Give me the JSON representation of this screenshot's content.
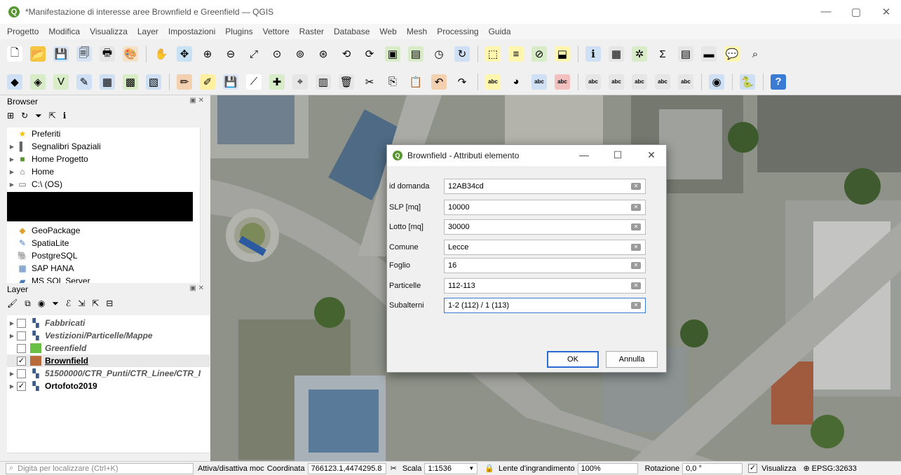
{
  "window": {
    "title": "*Manifestazione di interesse aree Brownfield e Greenfield — QGIS",
    "logo_letter": "Q",
    "minimize": "—",
    "maximize": "▢",
    "close": "✕"
  },
  "menu": [
    "Progetto",
    "Modifica",
    "Visualizza",
    "Layer",
    "Impostazioni",
    "Plugins",
    "Vettore",
    "Raster",
    "Database",
    "Web",
    "Mesh",
    "Processing",
    "Guida"
  ],
  "toolbar1": [
    {
      "name": "new-project-icon",
      "glyph": "🗋",
      "color": "#ffffff"
    },
    {
      "name": "open-project-icon",
      "glyph": "📂",
      "color": "#f5c542"
    },
    {
      "name": "save-project-icon",
      "glyph": "💾",
      "color": "#d8e4f4"
    },
    {
      "name": "save-as-icon",
      "glyph": "🗐",
      "color": "#d8e4f4"
    },
    {
      "name": "print-layout-icon",
      "glyph": "🖶",
      "color": "#e6e6e6"
    },
    {
      "name": "style-manager-icon",
      "glyph": "🎨",
      "color": "#f3e2c8"
    },
    {
      "name": "sep"
    },
    {
      "name": "pan-icon",
      "glyph": "✋",
      "color": "#f0f0f0"
    },
    {
      "name": "pan-to-selection-icon",
      "glyph": "✥",
      "color": "#c8e2f4"
    },
    {
      "name": "zoom-in-icon",
      "glyph": "⊕",
      "color": "#f0f0f0"
    },
    {
      "name": "zoom-out-icon",
      "glyph": "⊖",
      "color": "#f0f0f0"
    },
    {
      "name": "zoom-full-icon",
      "glyph": "⤢",
      "color": "#f0f0f0"
    },
    {
      "name": "zoom-selection-icon",
      "glyph": "⊙",
      "color": "#f0f0f0"
    },
    {
      "name": "zoom-layer-icon",
      "glyph": "⊚",
      "color": "#f0f0f0"
    },
    {
      "name": "zoom-native-icon",
      "glyph": "⊛",
      "color": "#f0f0f0"
    },
    {
      "name": "zoom-last-icon",
      "glyph": "⟲",
      "color": "#f0f0f0"
    },
    {
      "name": "zoom-next-icon",
      "glyph": "⟳",
      "color": "#f0f0f0"
    },
    {
      "name": "new-bookmark-icon",
      "glyph": "▣",
      "color": "#d9ecc8"
    },
    {
      "name": "show-bookmarks-icon",
      "glyph": "▤",
      "color": "#d9ecc8"
    },
    {
      "name": "temporal-icon",
      "glyph": "◷",
      "color": "#f0f0f0"
    },
    {
      "name": "refresh-icon",
      "glyph": "↻",
      "color": "#cfe0f5"
    },
    {
      "name": "sep"
    },
    {
      "name": "select-features-icon",
      "glyph": "⬚",
      "color": "#fff6b0"
    },
    {
      "name": "select-value-icon",
      "glyph": "≡",
      "color": "#fff6b0"
    },
    {
      "name": "deselect-icon",
      "glyph": "⊘",
      "color": "#d9ecc8"
    },
    {
      "name": "select-location-icon",
      "glyph": "⬓",
      "color": "#fff6b0"
    },
    {
      "name": "sep"
    },
    {
      "name": "identify-icon",
      "glyph": "ℹ",
      "color": "#cfe0f5"
    },
    {
      "name": "attribute-table-icon",
      "glyph": "▦",
      "color": "#e6e6e6"
    },
    {
      "name": "settings-icon",
      "glyph": "✲",
      "color": "#d9ecc8"
    },
    {
      "name": "statistics-icon",
      "glyph": "Σ",
      "color": "#f0f0f0"
    },
    {
      "name": "measure-icon",
      "glyph": "▤",
      "color": "#e6e6e6"
    },
    {
      "name": "map-tips-icon",
      "glyph": "▬",
      "color": "#e6e6e6"
    },
    {
      "name": "annotation-icon",
      "glyph": "💬",
      "color": "#fff6b0"
    },
    {
      "name": "locator-icon",
      "glyph": "⌕",
      "color": "#f0f0f0"
    }
  ],
  "toolbar2": [
    {
      "name": "add-vector-layer-icon",
      "glyph": "◆",
      "color": "#cfe0f5"
    },
    {
      "name": "add-raster-layer-icon",
      "glyph": "◈",
      "color": "#d9ecc8"
    },
    {
      "name": "add-delimited-icon",
      "glyph": "V",
      "color": "#d9ecc8"
    },
    {
      "name": "add-spatialite-icon",
      "glyph": "✎",
      "color": "#cfe0f5"
    },
    {
      "name": "add-wms-icon",
      "glyph": "▦",
      "color": "#cfe0f5"
    },
    {
      "name": "add-virtual-layer-icon",
      "glyph": "▩",
      "color": "#d9ecc8"
    },
    {
      "name": "add-mesh-icon",
      "glyph": "▧",
      "color": "#cfe0f5"
    },
    {
      "name": "sep"
    },
    {
      "name": "current-edits-icon",
      "glyph": "✏",
      "color": "#f3d0b0"
    },
    {
      "name": "toggle-editing-icon",
      "glyph": "✐",
      "color": "#fff0a0"
    },
    {
      "name": "save-edits-icon",
      "glyph": "💾",
      "color": "#d8e4f4"
    },
    {
      "name": "digitize-line-icon",
      "glyph": "⟋",
      "color": "#ffffff"
    },
    {
      "name": "add-feature-icon",
      "glyph": "✚",
      "color": "#d9ecc8"
    },
    {
      "name": "vertex-tool-icon",
      "glyph": "⌖",
      "color": "#e6e6e6"
    },
    {
      "name": "modify-attributes-icon",
      "glyph": "▥",
      "color": "#e6e6e6"
    },
    {
      "name": "delete-selected-icon",
      "glyph": "🗑",
      "color": "#e6e6e6"
    },
    {
      "name": "cut-features-icon",
      "glyph": "✂",
      "color": "#f0f0f0"
    },
    {
      "name": "copy-features-icon",
      "glyph": "⎘",
      "color": "#f0f0f0"
    },
    {
      "name": "paste-features-icon",
      "glyph": "📋",
      "color": "#f0f0f0"
    },
    {
      "name": "undo-icon",
      "glyph": "↶",
      "color": "#f3d0b0"
    },
    {
      "name": "redo-icon",
      "glyph": "↷",
      "color": "#f0f0f0"
    },
    {
      "name": "sep"
    },
    {
      "name": "label-toolbar-icon",
      "glyph": "abc",
      "color": "#fff6b0"
    },
    {
      "name": "layer-diagram-icon",
      "glyph": "◕",
      "color": "#f0f0f0"
    },
    {
      "name": "highlight-labels-icon",
      "glyph": "abc",
      "color": "#cfe0f5"
    },
    {
      "name": "pin-labels-icon",
      "glyph": "abc",
      "color": "#f3c0c0"
    },
    {
      "name": "sep"
    },
    {
      "name": "show-hide-labels-icon",
      "glyph": "abc",
      "color": "#e6e6e6"
    },
    {
      "name": "move-label-icon",
      "glyph": "abc",
      "color": "#e6e6e6"
    },
    {
      "name": "rotate-label-icon",
      "glyph": "abc",
      "color": "#e6e6e6"
    },
    {
      "name": "change-label-icon",
      "glyph": "abc",
      "color": "#e6e6e6"
    },
    {
      "name": "label-properties-icon",
      "glyph": "abc",
      "color": "#e6e6e6"
    },
    {
      "name": "sep"
    },
    {
      "name": "plugin-globe-icon",
      "glyph": "◉",
      "color": "#cfe0f5"
    },
    {
      "name": "sep"
    },
    {
      "name": "python-console-icon",
      "glyph": "🐍",
      "color": "#cfe0f5"
    },
    {
      "name": "sep"
    },
    {
      "name": "help-icon",
      "glyph": "?",
      "color": "#3a7bd5"
    }
  ],
  "browser": {
    "title": "Browser",
    "dock_controls": "▣ ✕",
    "tools": [
      {
        "name": "add-selected-icon",
        "glyph": "⊞"
      },
      {
        "name": "refresh-browser-icon",
        "glyph": "↻"
      },
      {
        "name": "filter-browser-icon",
        "glyph": "⏷"
      },
      {
        "name": "collapse-all-icon",
        "glyph": "⇱"
      },
      {
        "name": "properties-icon",
        "glyph": "ℹ"
      }
    ],
    "items": [
      {
        "label": "Preferiti",
        "icon": "star-icon",
        "glyph": "★",
        "color": "#f5c000",
        "arrow": ""
      },
      {
        "label": "Segnalibri Spaziali",
        "icon": "bookmark-icon",
        "glyph": "▌",
        "color": "#666666",
        "arrow": "▶"
      },
      {
        "label": "Home Progetto",
        "icon": "project-home-icon",
        "glyph": "■",
        "color": "#589632",
        "arrow": "▶"
      },
      {
        "label": "Home",
        "icon": "home-folder-icon",
        "glyph": "⌂",
        "color": "#666666",
        "arrow": "▶"
      },
      {
        "label": "C:\\ (OS)",
        "icon": "drive-icon",
        "glyph": "▭",
        "color": "#666666",
        "arrow": "▶"
      },
      {
        "label": "",
        "icon": "redacted-icon",
        "glyph": "",
        "color": "#000000",
        "arrow": ""
      },
      {
        "label": "GeoPackage",
        "icon": "geopackage-icon",
        "glyph": "◆",
        "color": "#e0a030",
        "arrow": ""
      },
      {
        "label": "SpatiaLite",
        "icon": "spatialite-icon",
        "glyph": "✎",
        "color": "#4a7ab8",
        "arrow": ""
      },
      {
        "label": "PostgreSQL",
        "icon": "postgresql-icon",
        "glyph": "🐘",
        "color": "#336791",
        "arrow": ""
      },
      {
        "label": "SAP HANA",
        "icon": "sap-hana-icon",
        "glyph": "▦",
        "color": "#4a7ab8",
        "arrow": ""
      },
      {
        "label": "MS SQL Server",
        "icon": "mssql-icon",
        "glyph": "▰",
        "color": "#4a7ab8",
        "arrow": ""
      }
    ]
  },
  "layers": {
    "title": "Layer",
    "dock_controls": "▣ ✕",
    "tools": [
      {
        "name": "style-layer-icon",
        "glyph": "🖌"
      },
      {
        "name": "add-group-icon",
        "glyph": "⧉"
      },
      {
        "name": "manage-visibility-icon",
        "glyph": "◉"
      },
      {
        "name": "filter-legend-icon",
        "glyph": "⏷"
      },
      {
        "name": "filter-expression-icon",
        "glyph": "ℰ"
      },
      {
        "name": "expand-all-icon",
        "glyph": "⇲"
      },
      {
        "name": "collapse-all-layers-icon",
        "glyph": "⇱"
      },
      {
        "name": "remove-layer-icon",
        "glyph": "⊟"
      }
    ],
    "items": [
      {
        "label": "Fabbricati",
        "italic": true,
        "bold": true,
        "checked": false,
        "arrow": "▶",
        "icon": "group-icon",
        "swatch": ""
      },
      {
        "label": "Vestizioni/Particelle/Mappe",
        "italic": true,
        "bold": true,
        "checked": false,
        "arrow": "▶",
        "icon": "group-icon",
        "swatch": ""
      },
      {
        "label": "Greenfield",
        "italic": true,
        "bold": true,
        "checked": false,
        "arrow": "",
        "icon": "polygon-swatch-icon",
        "swatch": "#6abf45"
      },
      {
        "label": "Brownfield",
        "italic": false,
        "bold": true,
        "underline": true,
        "checked": true,
        "arrow": "",
        "icon": "polygon-swatch-icon",
        "swatch": "#b86a3a",
        "selected": true
      },
      {
        "label": "51500000/CTR_Punti/CTR_Linee/CTR_I",
        "italic": true,
        "bold": true,
        "checked": false,
        "arrow": "▶",
        "icon": "group-icon",
        "swatch": ""
      },
      {
        "label": "Ortofoto2019",
        "italic": false,
        "bold": true,
        "checked": true,
        "arrow": "▶",
        "icon": "group-icon",
        "swatch": ""
      }
    ]
  },
  "dialog": {
    "title": "Brownfield - Attributi elemento",
    "minimize": "—",
    "maximize": "☐",
    "close": "✕",
    "clear_glyph": "✕",
    "fields": [
      {
        "label": "id domanda",
        "value": "12AB34cd"
      },
      {
        "label": "SLP [mq]",
        "value": "10000"
      },
      {
        "label": "Lotto [mq]",
        "value": "30000"
      },
      {
        "label": "Comune",
        "value": "Lecce"
      },
      {
        "label": "Foglio",
        "value": "16"
      },
      {
        "label": "Particelle",
        "value": "112-113"
      },
      {
        "label": "Subalterni",
        "value": "1-2 (112) / 1 (113)"
      }
    ],
    "ok_label": "OK",
    "cancel_label": "Annulla"
  },
  "statusbar": {
    "locator_placeholder": "Digita per localizzare (Ctrl+K)",
    "toggle_label": "Attiva/disattiva moc",
    "coordinate_label": "Coordinata",
    "coordinate_value": "766123.1,4474295.8",
    "scale_label": "Scala",
    "scale_value": "1:1536",
    "magnifier_label": "Lente d'ingrandimento",
    "magnifier_value": "100%",
    "rotation_label": "Rotazione",
    "rotation_value": "0,0 °",
    "render_label": "Visualizza",
    "crs_label": "EPSG:32633"
  }
}
